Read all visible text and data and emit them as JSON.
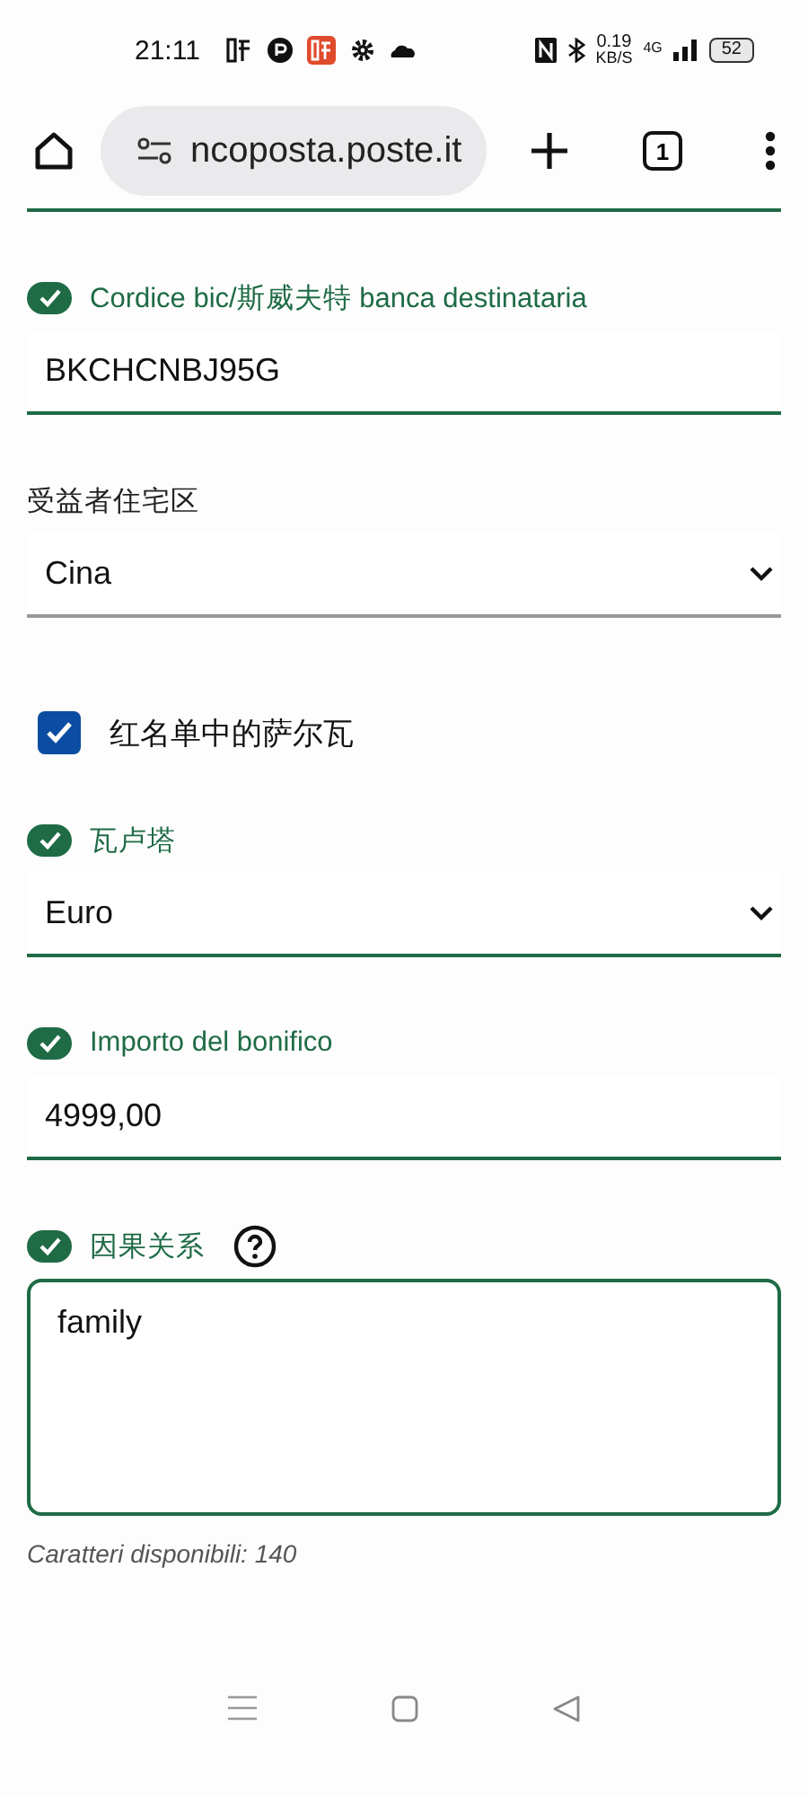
{
  "status_bar": {
    "time": "21:11",
    "net_speed": "0.19",
    "net_unit": "KB/S",
    "network": "4G",
    "battery": "52"
  },
  "browser": {
    "url": "ncoposta.poste.it",
    "tab_count": "1"
  },
  "fields": [
    {
      "kind": "text",
      "label": "Cordice bic/斯威夫特 banca destinataria",
      "valid": true,
      "value": "BKCHCNBJ95G"
    },
    {
      "kind": "select",
      "label": "受益者住宅区",
      "valid": false,
      "value": "Cina"
    },
    {
      "kind": "checkbox",
      "label": "红名单中的萨尔瓦",
      "checked": true
    },
    {
      "kind": "select",
      "label": "瓦卢塔",
      "valid": true,
      "value": "Euro"
    },
    {
      "kind": "text",
      "label": "Importo del bonifico",
      "valid": true,
      "value": "4999,00"
    },
    {
      "kind": "textarea",
      "label": "因果关系",
      "valid": true,
      "help": true,
      "value": "family",
      "counter": "Caratteri disponibili: 140"
    }
  ]
}
